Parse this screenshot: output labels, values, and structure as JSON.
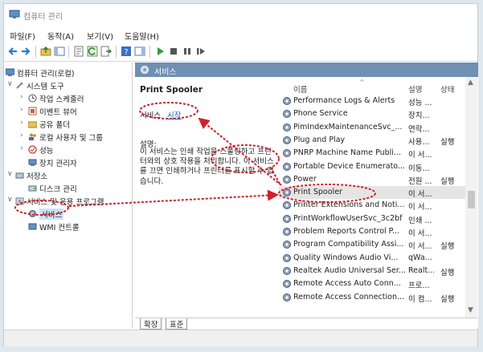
{
  "window": {
    "title": "컴퓨터 관리"
  },
  "menu": [
    "파일(F)",
    "동작(A)",
    "보기(V)",
    "도움말(H)"
  ],
  "tree": [
    {
      "label": "컴퓨터 관리(로컬)",
      "chev": "",
      "icon": "computer-icon",
      "level": 0
    },
    {
      "label": "시스템 도구",
      "chev": "∨",
      "icon": "tools-icon",
      "level": 1
    },
    {
      "label": "작업 스케줄러",
      "chev": "›",
      "icon": "clock-icon",
      "level": 2
    },
    {
      "label": "이벤트 뷰어",
      "chev": "›",
      "icon": "event-viewer-icon",
      "level": 2
    },
    {
      "label": "공유 폴더",
      "chev": "›",
      "icon": "shared-folder-icon",
      "level": 2
    },
    {
      "label": "로컬 사용자 및 그룹",
      "chev": "›",
      "icon": "users-icon",
      "level": 2
    },
    {
      "label": "성능",
      "chev": "›",
      "icon": "performance-icon",
      "level": 2
    },
    {
      "label": "장치 관리자",
      "chev": "",
      "icon": "device-manager-icon",
      "level": 2
    },
    {
      "label": "저장소",
      "chev": "∨",
      "icon": "storage-icon",
      "level": 1
    },
    {
      "label": "디스크 관리",
      "chev": "",
      "icon": "disk-icon",
      "level": 2
    },
    {
      "label": "서비스 및 응용 프로그램",
      "chev": "∨",
      "icon": "services-apps-icon",
      "level": 1
    },
    {
      "label": "서비스",
      "chev": "",
      "icon": "service-gear-icon",
      "level": 2
    },
    {
      "label": "WMI 컨트롤",
      "chev": "",
      "icon": "wmi-icon",
      "level": 2
    }
  ],
  "panel_header": "서비스",
  "detail": {
    "service_name": "Print Spooler",
    "link_prefix": "서비스",
    "link_text": "시작",
    "desc_label": "설명:",
    "description": "이 서비스는 인쇄 작업을 스풀링하고 프린터와의 상호 작용을 처리합니다. 이 서비스를 끄면 인쇄하거나 프린터를 표시할 수 없습니다."
  },
  "columns": {
    "name": "이름",
    "description": "설명",
    "state": "상태"
  },
  "services": [
    {
      "name": "Performance Logs & Alerts",
      "desc": "성능 ...",
      "state": ""
    },
    {
      "name": "Phone Service",
      "desc": "장치...",
      "state": ""
    },
    {
      "name": "PimIndexMaintenanceSvc_...",
      "desc": "연락...",
      "state": ""
    },
    {
      "name": "Plug and Play",
      "desc": "사용...",
      "state": "실행"
    },
    {
      "name": "PNRP Machine Name Publi...",
      "desc": "이 서...",
      "state": ""
    },
    {
      "name": "Portable Device Enumerato...",
      "desc": "이동...",
      "state": ""
    },
    {
      "name": "Power",
      "desc": "전원 ...",
      "state": "실행"
    },
    {
      "name": "Print Spooler",
      "desc": "이 서...",
      "state": ""
    },
    {
      "name": "Printer Extensions and Noti...",
      "desc": "이 서...",
      "state": ""
    },
    {
      "name": "PrintWorkflowUserSvc_3c2bf",
      "desc": "인쇄 ...",
      "state": ""
    },
    {
      "name": "Problem Reports Control P...",
      "desc": "이 서...",
      "state": ""
    },
    {
      "name": "Program Compatibility Assi...",
      "desc": "이 서...",
      "state": "실행"
    },
    {
      "name": "Quality Windows Audio Vi...",
      "desc": "qWa...",
      "state": ""
    },
    {
      "name": "Realtek Audio Universal Ser...",
      "desc": "Realt...",
      "state": "실행"
    },
    {
      "name": "Remote Access Auto Conn...",
      "desc": "프로...",
      "state": ""
    },
    {
      "name": "Remote Access Connection...",
      "desc": "이 컴...",
      "state": "실행"
    }
  ],
  "tabs": [
    "확장",
    "표준"
  ],
  "colors": {
    "header_blue": "#6f8fb3",
    "annotation_red": "#d0202a",
    "selection": "#cce4f7"
  }
}
